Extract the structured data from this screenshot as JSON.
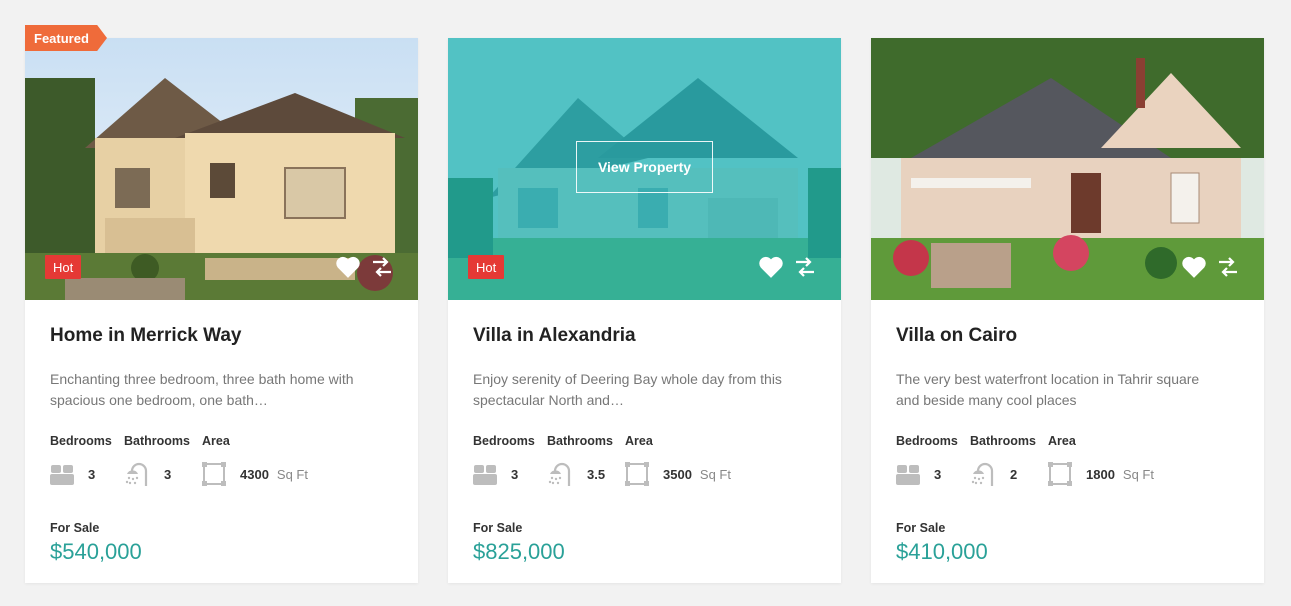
{
  "cards": [
    {
      "featured": "Featured",
      "badge": "Hot",
      "title": "Home in Merrick Way",
      "description": "Enchanting three bedroom, three bath home with spacious one bedroom, one bath…",
      "labels": {
        "bedrooms": "Bedrooms",
        "bathrooms": "Bathrooms",
        "area": "Area"
      },
      "bedrooms": "3",
      "bathrooms": "3",
      "area": "4300",
      "area_unit": "Sq Ft",
      "status": "For Sale",
      "price": "$540,000"
    },
    {
      "badge": "Hot",
      "view_label": "View Property",
      "title": "Villa in Alexandria",
      "description": "Enjoy serenity of Deering Bay whole day from this spectacular North and…",
      "labels": {
        "bedrooms": "Bedrooms",
        "bathrooms": "Bathrooms",
        "area": "Area"
      },
      "bedrooms": "3",
      "bathrooms": "3.5",
      "area": "3500",
      "area_unit": "Sq Ft",
      "status": "For Sale",
      "price": "$825,000"
    },
    {
      "title": "Villa on Cairo",
      "description": "The very best waterfront location in Tahrir square and beside many cool places",
      "labels": {
        "bedrooms": "Bedrooms",
        "bathrooms": "Bathrooms",
        "area": "Area"
      },
      "bedrooms": "3",
      "bathrooms": "2",
      "area": "1800",
      "area_unit": "Sq Ft",
      "status": "For Sale",
      "price": "$410,000"
    }
  ],
  "colors": {
    "accent": "#2aa198",
    "featured": "#ef6b3a",
    "hot": "#e53935",
    "overlay": "#1cb2b2"
  }
}
